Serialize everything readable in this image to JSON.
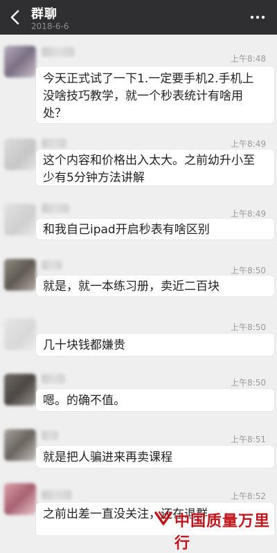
{
  "header": {
    "title": "群聊",
    "subtitle": "2018-6-6"
  },
  "messages": [
    {
      "time": "上午8:48",
      "text": "今天正式试了一下1.一定要手机2.手机上没啥技巧教学，就一个秒表统计有啥用处？"
    },
    {
      "time": "上午8:49",
      "text": "这个内容和价格出入太大。之前幼升小至少有5分钟方法讲解"
    },
    {
      "time": "上午8:49",
      "text": "和我自己ipad开启秒表有啥区别"
    },
    {
      "time": "上午8:50",
      "text": "就是，就一本练习册，卖近二百块"
    },
    {
      "time": "上午8:50",
      "text": "几十块钱都嫌贵"
    },
    {
      "time": "上午8:50",
      "text": "嗯。的确不值。"
    },
    {
      "time": "上午8:51",
      "text": "就是把人骗进来再卖课程"
    },
    {
      "time": "上午8:52",
      "text": "之前出差一直没关注，还在退群"
    }
  ],
  "watermark": {
    "text": "中国质量万里行"
  },
  "colors": {
    "topbar": "#2f2f31",
    "background": "#efefef",
    "bubble": "#ffffff",
    "watermark": "#c0151b"
  },
  "icons": {
    "back": "back-arrow-icon",
    "more": "more-dots-icon",
    "watermark_logo": "watermark-logo-icon"
  }
}
